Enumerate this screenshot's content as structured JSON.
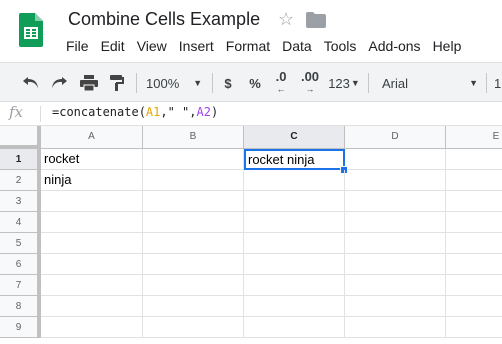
{
  "document": {
    "title": "Combine Cells Example",
    "star_glyph": "☆"
  },
  "menu": [
    "File",
    "Edit",
    "View",
    "Insert",
    "Format",
    "Data",
    "Tools",
    "Add-ons",
    "Help"
  ],
  "toolbar": {
    "zoom": "100%",
    "currency": "$",
    "percent": "%",
    "decrease_decimal": ".0",
    "increase_decimal": ".00",
    "more_formats": "123",
    "font": "Arial",
    "font_size": "1"
  },
  "formula_bar": {
    "fx_label": "fx",
    "formula_prefix": "=concatenate(",
    "ref1": "A1",
    "middle": ",\" \",",
    "ref2": "A2",
    "formula_suffix": ")"
  },
  "sheet": {
    "columns": [
      "A",
      "B",
      "C",
      "D",
      "E"
    ],
    "rows": [
      "1",
      "2",
      "3",
      "4",
      "5",
      "6",
      "7",
      "8",
      "9"
    ],
    "cells": {
      "A1": "rocket",
      "A2": "ninja",
      "C1": "rocket ninja"
    },
    "active_cell": "C1"
  },
  "colors": {
    "selection": "#1a73e8",
    "sheets_green": "#0f9d58",
    "ref1_color": "#e8a400",
    "ref2_color": "#a142f4"
  }
}
